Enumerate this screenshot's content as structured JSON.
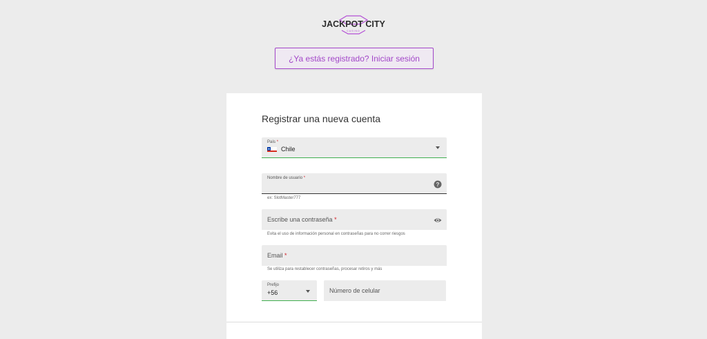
{
  "header": {
    "logo_text": "JACKPOT CITY",
    "logo_subtext": "CASINO",
    "login_button": "¿Ya estás registrado? Iniciar sesión"
  },
  "form": {
    "title": "Registrar una nueva cuenta",
    "country": {
      "label": "País",
      "required": "*",
      "value": "Chile",
      "flag_icon": "chile-flag-icon"
    },
    "username": {
      "label": "Nombre de usuario",
      "required": "*",
      "helper": "ex: SlotMaster777",
      "icon": "help-icon"
    },
    "password": {
      "placeholder": "Escribe una contraseña",
      "required": "*",
      "helper": "Evita el uso de información personal en contraseñas para no correr riesgos",
      "icon": "eye-icon"
    },
    "email": {
      "placeholder": "Email",
      "required": "*",
      "helper": "Se utiliza para restablecer contraseñas, procesar retiros y más"
    },
    "prefix": {
      "label": "Prefijo",
      "value": "+56"
    },
    "phone": {
      "placeholder": "Número de celular"
    }
  },
  "colors": {
    "accent": "#a347c9",
    "success": "#3fae4e",
    "required": "#d3232a"
  }
}
